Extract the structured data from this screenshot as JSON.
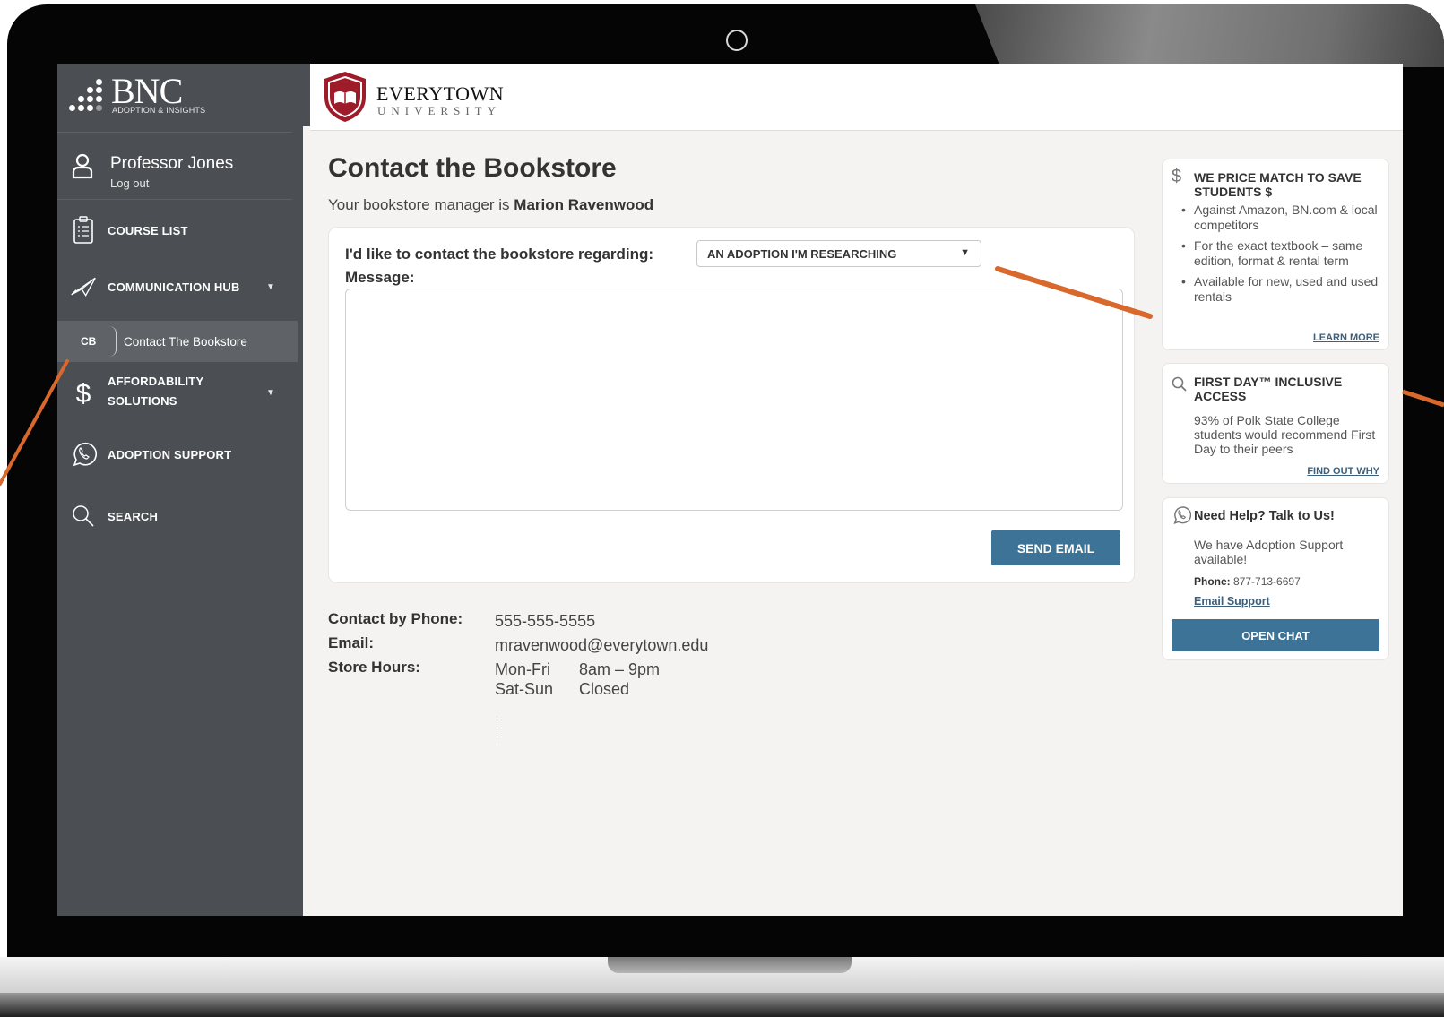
{
  "brand": {
    "name": "BNC",
    "subtitle": "ADOPTION & INSIGHTS",
    "collapse": "‹"
  },
  "user": {
    "name": "Professor Jones",
    "logout": "Log out"
  },
  "nav": {
    "course_list": "COURSE LIST",
    "communication_hub": "COMMUNICATION HUB",
    "sub_code": "CB",
    "sub_label": "Contact The Bookstore",
    "affordability_1": "AFFORDABILITY",
    "affordability_2": "SOLUTIONS",
    "adoption_support": "ADOPTION SUPPORT",
    "search": "SEARCH",
    "caret": "▼"
  },
  "header": {
    "university_name": "EVERYTOWN",
    "university_sub": "UNIVERSITY"
  },
  "main": {
    "title": "Contact the Bookstore",
    "manager_prefix": "Your bookstore manager is ",
    "manager_name": "Marion Ravenwood",
    "regarding_label": "I'd like to contact the bookstore regarding:",
    "regarding_value": "AN ADOPTION I'M RESEARCHING",
    "regarding_arrow": "▼",
    "message_label": "Message:",
    "message_value": "",
    "send_button": "SEND EMAIL",
    "phone_label": "Contact by Phone:",
    "phone_value": "555-555-5555",
    "email_label": "Email:",
    "email_value": "mravenwood@everytown.edu",
    "hours_label": "Store Hours:",
    "hours": [
      {
        "days": "Mon-Fri",
        "time": "8am – 9pm"
      },
      {
        "days": "Sat-Sun",
        "time": "Closed"
      }
    ]
  },
  "cards": {
    "price_match": {
      "icon": "$",
      "title": "WE PRICE MATCH TO SAVE STUDENTS $",
      "bullets": [
        "Against Amazon, BN.com & local competitors",
        "For the exact textbook – same edition, format & rental term",
        "Available for new, used and used rentals"
      ],
      "link": "LEARN MORE"
    },
    "first_day": {
      "title": "FIRST DAY™ INCLUSIVE ACCESS",
      "text": "93% of Polk State College students would recommend First Day to their peers",
      "link": "FIND OUT WHY"
    },
    "help": {
      "title": "Need Help? Talk to Us!",
      "text": "We have Adoption Support available!",
      "phone_label": "Phone:",
      "phone_value": "877-713-6697",
      "email_link": "Email Support",
      "chat_button": "OPEN CHAT"
    }
  },
  "colors": {
    "sidebar": "#4b4f53",
    "accent": "#3d7396",
    "annotation": "#d9682d",
    "logo_red": "#9e1b2a"
  }
}
